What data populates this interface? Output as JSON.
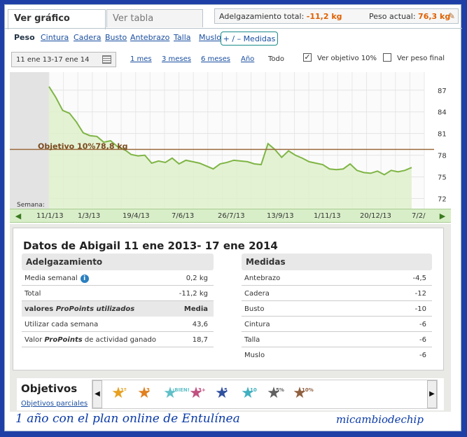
{
  "tabs": {
    "graph": "Ver gráfico",
    "table": "Ver tabla"
  },
  "summary": {
    "loss_label": "Adelgazamiento total:",
    "loss_value": "-11,2 kg",
    "weight_label": "Peso actual:",
    "weight_value": "76,3 kg"
  },
  "measures": {
    "items": [
      "Peso",
      "Cintura",
      "Cadera",
      "Busto",
      "Antebrazo",
      "Talla",
      "Muslo"
    ],
    "button": "+ / – Medidas"
  },
  "range": {
    "date": "11 ene 13-17 ene 14",
    "links": [
      "1 mes",
      "3 meses",
      "6 meses",
      "Año"
    ],
    "all": "Todo",
    "goal_check": "Ver objetivo 10%",
    "final_check": "Ver peso final"
  },
  "chart_data": {
    "type": "area",
    "x": [
      "11/1/13",
      "18/1/13",
      "25/1/13",
      "1/2/13",
      "8/2/13",
      "15/2/13",
      "22/2/13",
      "1/3/13",
      "8/3/13",
      "15/3/13",
      "22/3/13",
      "29/3/13",
      "5/4/13",
      "12/4/13",
      "19/4/13",
      "26/4/13",
      "3/5/13",
      "10/5/13",
      "17/5/13",
      "24/5/13",
      "31/5/13",
      "7/6/13",
      "14/6/13",
      "21/6/13",
      "28/6/13",
      "5/7/13",
      "12/7/13",
      "19/7/13",
      "26/7/13",
      "2/8/13",
      "9/8/13",
      "16/8/13",
      "23/8/13",
      "30/8/13",
      "6/9/13",
      "13/9/13",
      "20/9/13",
      "27/9/13",
      "4/10/13",
      "11/10/13",
      "18/10/13",
      "25/10/13",
      "1/11/13",
      "8/11/13",
      "15/11/13",
      "22/11/13",
      "29/11/13",
      "6/12/13",
      "13/12/13",
      "20/12/13",
      "27/12/13",
      "3/1/14",
      "10/1/14",
      "17/1/14"
    ],
    "values": [
      87.5,
      86.0,
      84.2,
      83.8,
      82.6,
      81.1,
      80.7,
      80.6,
      79.8,
      80.0,
      79.2,
      78.8,
      78.1,
      77.9,
      78.0,
      76.9,
      77.2,
      77.0,
      77.6,
      76.8,
      77.3,
      77.1,
      76.9,
      76.5,
      76.1,
      76.8,
      77.0,
      77.3,
      77.2,
      77.1,
      76.8,
      76.7,
      79.6,
      78.8,
      77.7,
      78.6,
      78.0,
      77.6,
      77.1,
      76.9,
      76.7,
      76.1,
      76.0,
      76.1,
      76.8,
      75.9,
      75.6,
      75.5,
      75.8,
      75.3,
      75.9,
      75.7,
      75.9,
      76.3
    ],
    "ticks_x": [
      "11/1/13",
      "1/3/13",
      "19/4/13",
      "7/6/13",
      "26/7/13",
      "13/9/13",
      "1/11/13",
      "20/12/13",
      "7/2/"
    ],
    "ticks_y": [
      72,
      75,
      78,
      81,
      84,
      87
    ],
    "ylim": [
      70.5,
      89.5
    ],
    "goal": {
      "label": "Objetivo 10%78,8 kg",
      "value": 78.8
    },
    "xlabel": "Semana:"
  },
  "details": {
    "title": "Datos de Abigail 11 ene 2013- 17 ene 2014",
    "loss_section": "Adelgazamiento",
    "loss_rows": [
      {
        "label": "Media semanal",
        "value": "0,2  kg"
      },
      {
        "label": "Total",
        "value": "-11,2  kg"
      }
    ],
    "pp_label_pre": "valores ",
    "pp_label_em": "ProPoints utilizados",
    "pp_media": "Media",
    "pp_rows": [
      {
        "label": "Utilizar cada semana",
        "value": "43,6"
      },
      {
        "label_pre": "Valor ",
        "label_em": "ProPoints",
        "label_post": " de actividad ganado",
        "value": "18,7"
      }
    ],
    "measures_section": "Medidas",
    "measure_rows": [
      {
        "label": "Antebrazo",
        "value": "-4,5"
      },
      {
        "label": "Cadera",
        "value": "-12"
      },
      {
        "label": "Busto",
        "value": "-10"
      },
      {
        "label": "Cintura",
        "value": "-6"
      },
      {
        "label": "Talla",
        "value": "-6"
      },
      {
        "label": "Muslo",
        "value": "-6"
      }
    ]
  },
  "goals": {
    "title": "Objetivos",
    "link": "Objetivos parciales",
    "badges": [
      {
        "text": "1º",
        "color": "#e8a020"
      },
      {
        "text": "3",
        "color": "#e08020"
      },
      {
        "text": "¡BIEN!",
        "color": "#60c0c8"
      },
      {
        "text": "3+",
        "color": "#c05080"
      },
      {
        "text": "5",
        "color": "#3050a0"
      },
      {
        "text": "10",
        "color": "#40b0c0"
      },
      {
        "text": "5%",
        "color": "#606060"
      },
      {
        "text": "10%",
        "color": "#906040"
      }
    ]
  },
  "captions": {
    "left": "1 año con el plan online de Entulínea",
    "right": "micambiodechip"
  }
}
